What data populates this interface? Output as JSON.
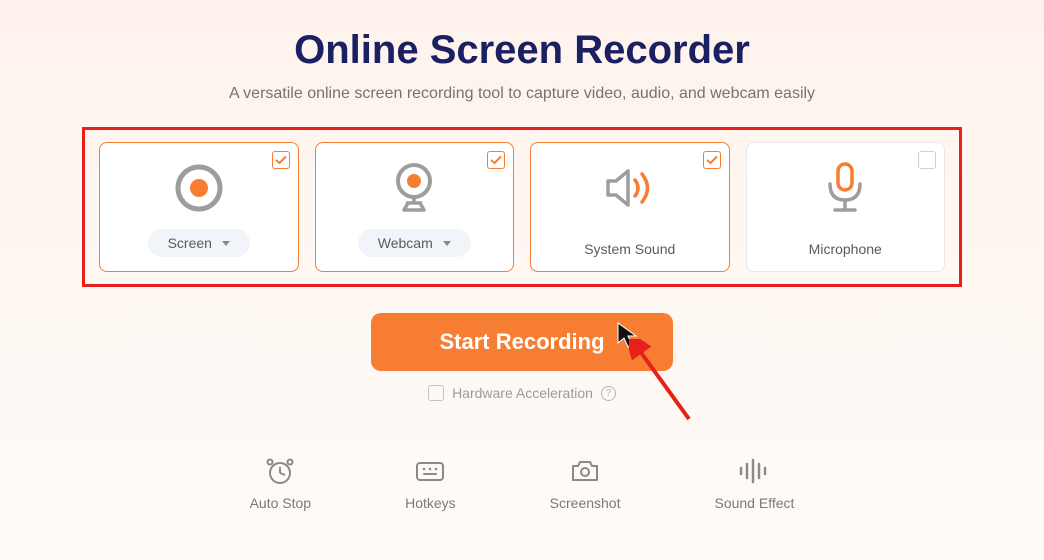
{
  "header": {
    "title": "Online Screen Recorder",
    "subtitle": "A versatile online screen recording tool to capture video, audio, and webcam easily"
  },
  "cards": {
    "screen": {
      "label": "Screen",
      "checked": true
    },
    "webcam": {
      "label": "Webcam",
      "checked": true
    },
    "system_sound": {
      "label": "System Sound",
      "checked": true
    },
    "microphone": {
      "label": "Microphone",
      "checked": false
    }
  },
  "actions": {
    "start_label": "Start Recording",
    "hw_accel_label": "Hardware Acceleration"
  },
  "tools": {
    "auto_stop": "Auto Stop",
    "hotkeys": "Hotkeys",
    "screenshot": "Screenshot",
    "sound_effect": "Sound Effect"
  },
  "colors": {
    "accent": "#f77d33",
    "title": "#1a2061",
    "highlight": "#e8201b"
  }
}
